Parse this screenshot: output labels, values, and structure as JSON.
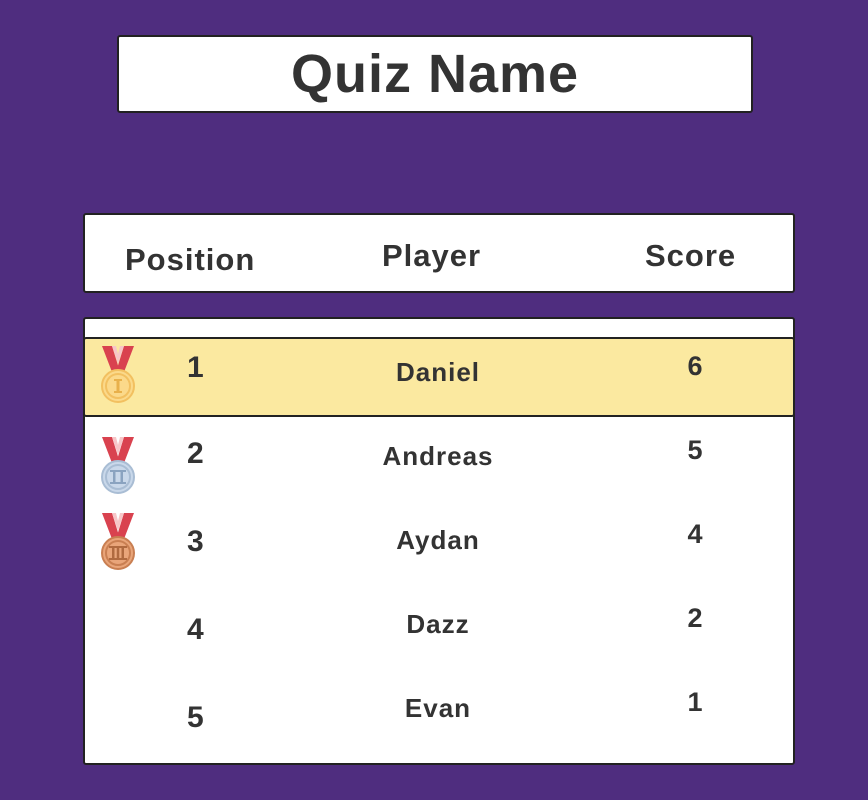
{
  "quiz": {
    "title": "Quiz Name"
  },
  "table": {
    "headers": {
      "position": "Position",
      "player": "Player",
      "score": "Score"
    },
    "rows": [
      {
        "position": "1",
        "player": "Daniel",
        "score": "6",
        "medal": "gold-medal-icon",
        "highlighted": true
      },
      {
        "position": "2",
        "player": "Andreas",
        "score": "5",
        "medal": "silver-medal-icon",
        "highlighted": false
      },
      {
        "position": "3",
        "player": "Aydan",
        "score": "4",
        "medal": "bronze-medal-icon",
        "highlighted": false
      },
      {
        "position": "4",
        "player": "Dazz",
        "score": "2",
        "medal": "",
        "highlighted": false
      },
      {
        "position": "5",
        "player": "Evan",
        "score": "1",
        "medal": "",
        "highlighted": false
      }
    ]
  },
  "colors": {
    "background": "#4f2d7f",
    "highlight": "#fbe9a0",
    "text": "#333333",
    "ribbon": "#d9424f",
    "gold": "#fbd98a",
    "silver": "#c9d8ea",
    "bronze": "#e9a57a"
  }
}
